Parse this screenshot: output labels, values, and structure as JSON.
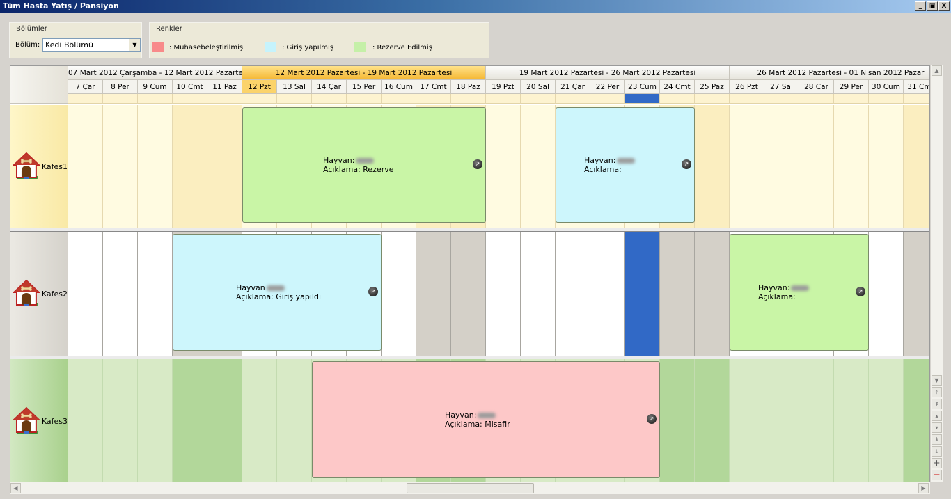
{
  "window": {
    "title": "Tüm Hasta Yatış / Pansiyon",
    "buttons": [
      "_",
      "▣",
      "X"
    ]
  },
  "departments": {
    "title": "Bölümler",
    "label": "Bölüm:",
    "selected": "Kedi Bölümü"
  },
  "legend": {
    "title": "Renkler",
    "items": [
      {
        "label": ": Muhasebeleştirilmiş",
        "color": "#f88a8a"
      },
      {
        "label": ": Giriş yapılmış",
        "color": "#c6f3fc"
      },
      {
        "label": ": Rezerve Edilmiş",
        "color": "#c5f0a8"
      }
    ]
  },
  "weeks": [
    {
      "label": "07 Mart 2012 Çarşamba - 12 Mart 2012 Pazartesi",
      "active": false
    },
    {
      "label": "12 Mart 2012 Pazartesi - 19 Mart 2012 Pazartesi",
      "active": true
    },
    {
      "label": "19 Mart 2012 Pazartesi - 26 Mart 2012 Pazartesi",
      "active": false
    },
    {
      "label": "26 Mart 2012 Pazartesi - 01 Nisan 2012 Pazar",
      "active": false
    }
  ],
  "days": [
    "7 Çar",
    "8 Per",
    "9 Cum",
    "10 Cmt",
    "11 Paz",
    "12 Pzt",
    "13 Sal",
    "14 Çar",
    "15 Per",
    "16 Cum",
    "17 Cmt",
    "18 Paz",
    "19 Pzt",
    "20 Sal",
    "21 Çar",
    "22 Per",
    "23 Cum",
    "24 Cmt",
    "25 Paz",
    "26 Pzt",
    "27 Sal",
    "28 Çar",
    "29 Per",
    "30 Cum",
    "31 Cmt"
  ],
  "active_day": "12 Pzt",
  "today": "23 Cum",
  "resources": [
    {
      "name": "Kafes1",
      "theme": "yellow"
    },
    {
      "name": "Kafes2",
      "theme": "white"
    },
    {
      "name": "Kafes3",
      "theme": "green"
    }
  ],
  "appointments": [
    {
      "resource": "Kafes1",
      "start_day": "12 Pzt",
      "end_day": "18 Paz",
      "hayvan_label": "Hayvan:",
      "aciklama": "Açıklama: Rezerve",
      "status": "Rezerve Edilmiş",
      "color": "#c9f5a6"
    },
    {
      "resource": "Kafes1",
      "start_day": "21 Çar",
      "end_day": "24 Cmt",
      "hayvan_label": "Hayvan:",
      "aciklama": "Açıklama:",
      "status": "Giriş yapılmış",
      "color": "#cdf6fc"
    },
    {
      "resource": "Kafes2",
      "start_day": "10 Cmt",
      "end_day": "15 Per",
      "hayvan_label": "Hayvan",
      "aciklama": "Açıklama: Giriş yapıldı",
      "status": "Giriş yapılmış",
      "color": "#cdf6fc"
    },
    {
      "resource": "Kafes2",
      "start_day": "26 Pzt",
      "end_day": "29 Per",
      "hayvan_label": "Hayvan:",
      "aciklama": "Açıklama:",
      "status": "Rezerve Edilmiş",
      "color": "#c9f5a6"
    },
    {
      "resource": "Kafes3",
      "start_day": "14 Çar",
      "end_day": "23 Cum",
      "hayvan_label": "Hayvan:",
      "aciklama": "Açıklama: Misafir",
      "status": "Muhasebeleştirilmiş",
      "color": "#fdc8c8"
    }
  ],
  "colors": {
    "today": "#3169c6",
    "active_header": "#f5b733",
    "weekend_gray": "#d4d0c8"
  },
  "vscroll_buttons": [
    "up-arrow-icon",
    "down-arrow-icon",
    "first-icon",
    "prev-page-icon",
    "up-icon",
    "down-icon",
    "next-page-icon",
    "last-icon",
    "add-icon",
    "remove-icon"
  ]
}
